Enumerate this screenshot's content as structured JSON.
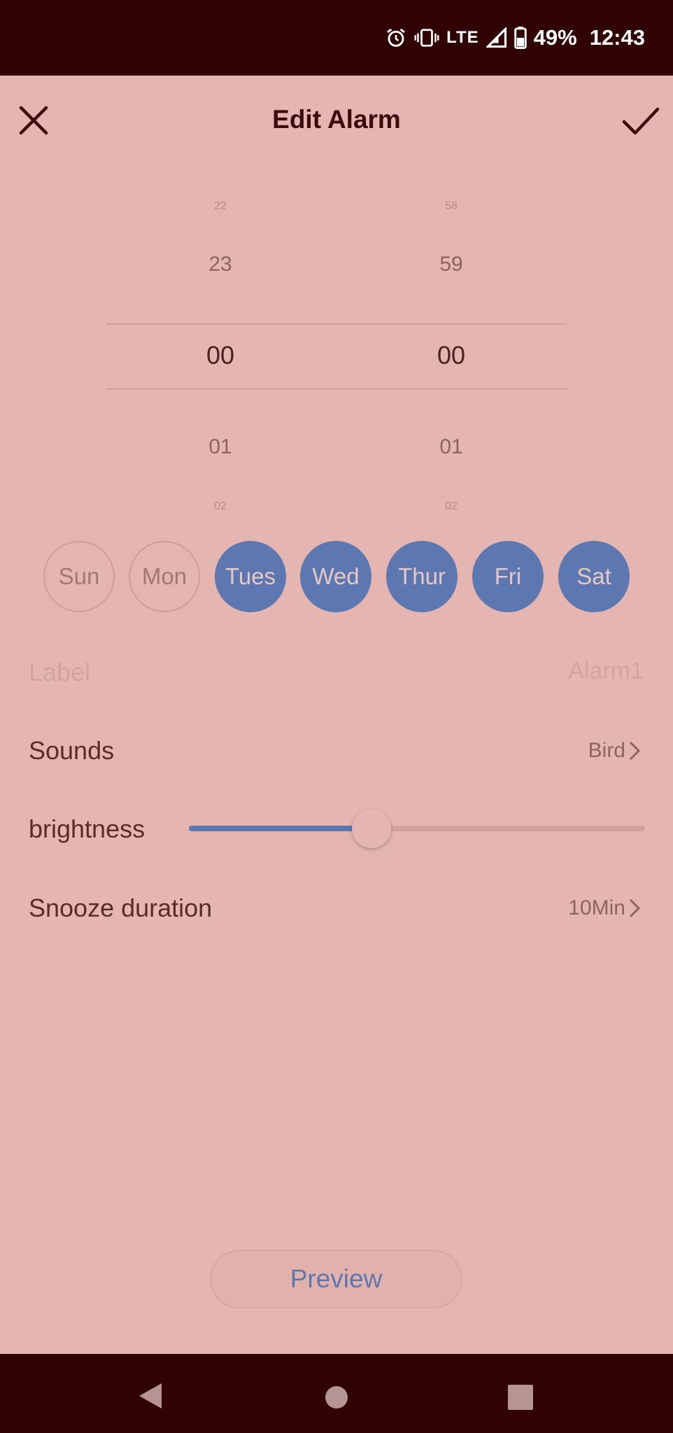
{
  "status_bar": {
    "battery_pct": "49%",
    "time": "12:43",
    "network": "LTE",
    "icons": [
      "alarm-icon",
      "vibrate-icon",
      "signal-icon",
      "battery-icon"
    ]
  },
  "header": {
    "title": "Edit Alarm",
    "close_icon": "close-icon",
    "confirm_icon": "check-icon"
  },
  "time_picker": {
    "hours": [
      "22",
      "23",
      "00",
      "01",
      "02"
    ],
    "minutes": [
      "58",
      "59",
      "00",
      "01",
      "02"
    ],
    "selected_hour": "00",
    "selected_minute": "00"
  },
  "repeat_days": [
    {
      "label": "Sun",
      "selected": false
    },
    {
      "label": "Mon",
      "selected": false
    },
    {
      "label": "Tues",
      "selected": true
    },
    {
      "label": "Wed",
      "selected": true
    },
    {
      "label": "Thur",
      "selected": true
    },
    {
      "label": "Fri",
      "selected": true
    },
    {
      "label": "Sat",
      "selected": true
    }
  ],
  "settings": {
    "label": {
      "title": "Label",
      "placeholder": "Alarm1"
    },
    "sounds": {
      "title": "Sounds",
      "value": "Bird"
    },
    "brightness": {
      "title": "brightness",
      "level": 0.4
    },
    "snooze": {
      "title": "Snooze duration",
      "value": "10Min"
    }
  },
  "preview_button": "Preview",
  "colors": {
    "background": "#e5b6b1",
    "system_bar": "#310203",
    "accent": "#5d78b0"
  }
}
